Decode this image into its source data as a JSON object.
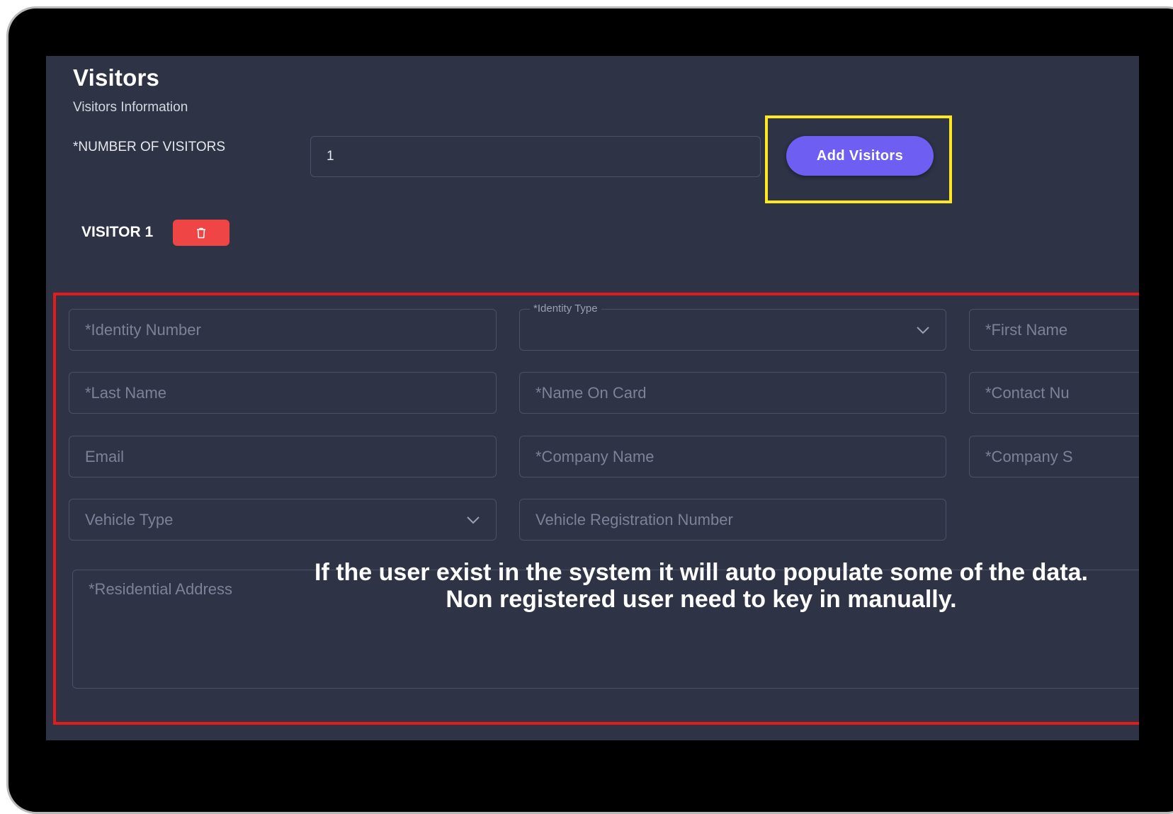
{
  "header": {
    "title": "Visitors",
    "subtitle": "Visitors Information"
  },
  "visitor_count": {
    "label": "*NUMBER OF VISITORS",
    "value": "1",
    "add_button": "Add Visitors"
  },
  "visitor": {
    "label": "VISITOR 1",
    "delete_icon": "trash-icon",
    "fields": {
      "identity_number": "*Identity Number",
      "identity_type_label": "*Identity Type",
      "first_name": "*First Name",
      "last_name": "*Last Name",
      "name_on_card": "*Name On Card",
      "contact_number": "*Contact Nu",
      "email": "Email",
      "company_name": "*Company Name",
      "company_s": "*Company S",
      "vehicle_type": "Vehicle Type",
      "vehicle_registration": "Vehicle Registration Number",
      "residential_address": "*Residential Address"
    }
  },
  "caption": {
    "line1": "If the user exist in the system it will auto populate some of the data.",
    "line2": "Non registered user need to key in manually."
  },
  "colors": {
    "screen_bg": "#2e3345",
    "accent": "#6e5ff2",
    "danger": "#f04545",
    "highlight_yellow": "#ffe81e",
    "highlight_red": "#e31b1b"
  }
}
